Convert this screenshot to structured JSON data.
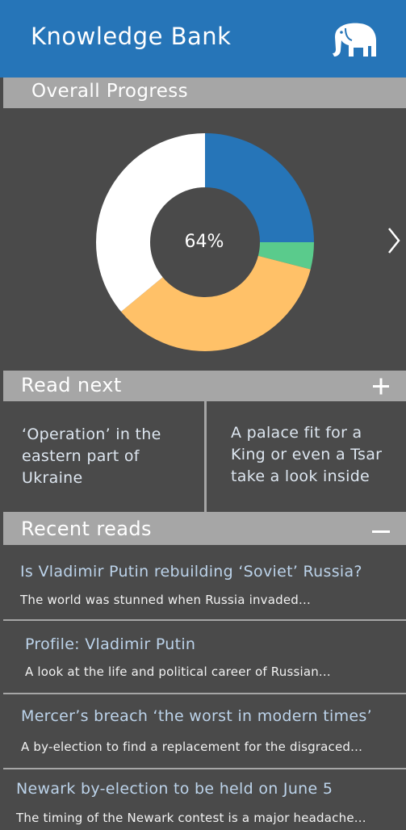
{
  "header": {
    "title": "Knowledge Bank",
    "logo": "elephant-icon"
  },
  "progress": {
    "section_label": "Overall Progress",
    "center_label": "64%",
    "segments": [
      {
        "value": 25,
        "color": "#2675b8"
      },
      {
        "value": 4,
        "color": "#5acb8c"
      },
      {
        "value": 35,
        "color": "#ffc168"
      },
      {
        "value": 36,
        "color": "#ffffff"
      }
    ],
    "next_icon": "chevron-right-icon"
  },
  "read_next": {
    "section_label": "Read next",
    "expand_icon": "plus-icon",
    "cards": [
      {
        "title": "‘Operation’ in the eastern part of Ukraine"
      },
      {
        "title": "A palace fit for a King or even a Tsar take a look inside"
      }
    ]
  },
  "recent_reads": {
    "section_label": "Recent reads",
    "collapse_icon": "minus-icon",
    "items": [
      {
        "title": "Is Vladimir Putin rebuilding ‘Soviet’ Russia?",
        "summary": "The world was stunned when Russia invaded..."
      },
      {
        "title": "Profile: Vladimir Putin",
        "summary": "A look at the life and political career of Russian..."
      },
      {
        "title": "Mercer’s breach ‘the worst in modern times’",
        "summary": "A by-election to find a replacement for the disgraced..."
      },
      {
        "title": "Newark by-election to be held on June 5",
        "summary": "The timing of the Newark contest is a major headache..."
      }
    ]
  },
  "colors": {
    "header": "#2675b8",
    "section_bar": "#a6a6a6",
    "background": "#4a4a4a",
    "recent_title": "#bcd3ea"
  }
}
